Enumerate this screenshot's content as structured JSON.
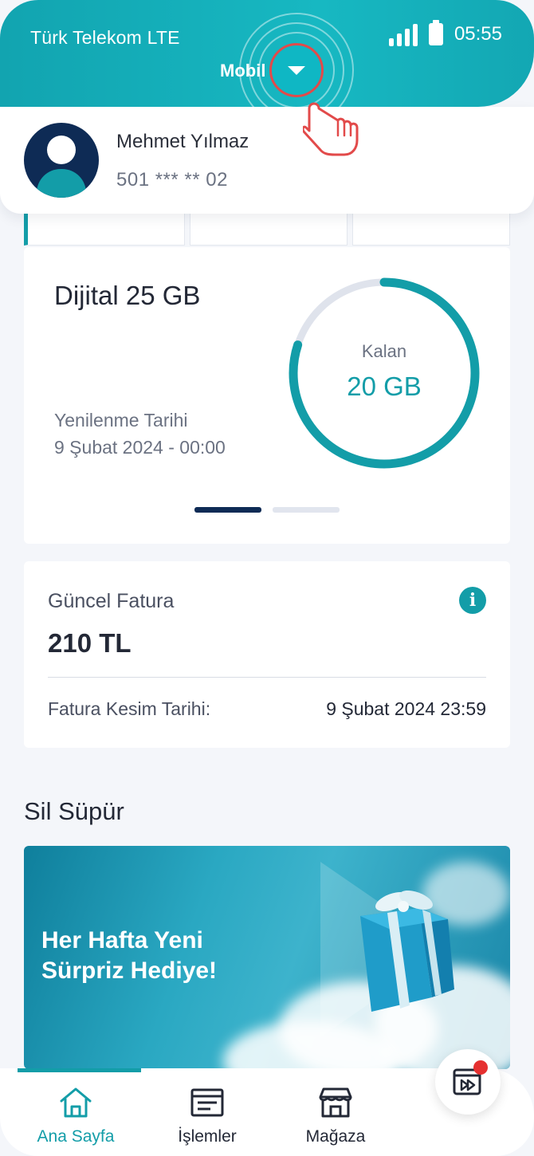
{
  "status_bar": {
    "carrier": "Türk Telekom LTE",
    "time": "05:55"
  },
  "line_selector": {
    "label": "Mobil"
  },
  "profile": {
    "name": "Mehmet Yılmaz",
    "phone": "501 *** ** 02"
  },
  "package": {
    "name": "Dijital 25 GB",
    "renewal_label": "Yenilenme Tarihi",
    "renewal_date": "9 Şubat 2024 - 00:00",
    "remaining_label": "Kalan",
    "remaining_value": "20 GB",
    "remaining_fraction": 0.8,
    "pager_active_index": 0,
    "pager_count": 2
  },
  "invoice": {
    "title": "Güncel Fatura",
    "amount": "210 TL",
    "date_label": "Fatura Kesim Tarihi:",
    "date_value": "9 Şubat 2024 23:59"
  },
  "campaign": {
    "section_title": "Sil Süpür",
    "banner_line1": "Her Hafta Yeni",
    "banner_line2": "Sürpriz Hediye!"
  },
  "bottom_nav": {
    "items": [
      {
        "label": "Ana Sayfa",
        "icon": "home-icon",
        "active": true
      },
      {
        "label": "İşlemler",
        "icon": "transactions-icon",
        "active": false
      },
      {
        "label": "Mağaza",
        "icon": "store-icon",
        "active": false
      }
    ],
    "fab_icon": "play-media-icon"
  },
  "colors": {
    "brand": "#139da8",
    "navy": "#0e2b55",
    "notification": "#e53030"
  }
}
